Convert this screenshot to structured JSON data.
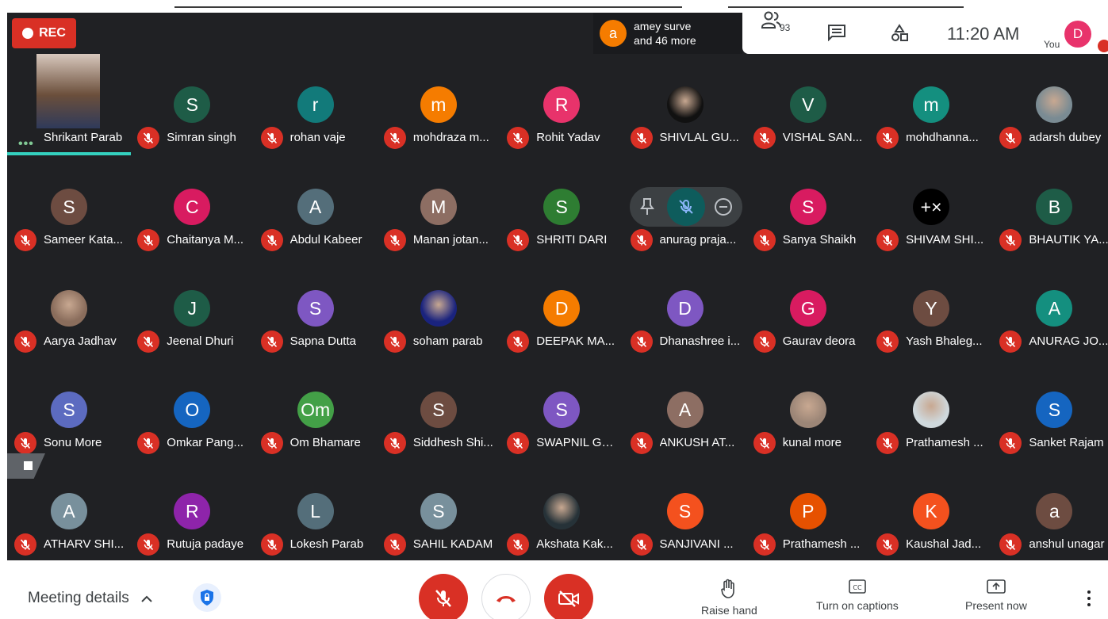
{
  "recording": {
    "label": "REC"
  },
  "speaker": {
    "avatar_letter": "a",
    "line1": "amey surve",
    "line2": "and 46 more"
  },
  "top_right": {
    "people_count": "93",
    "time": "11:20 AM",
    "you_label": "You",
    "self_initial": "D"
  },
  "participants": [
    {
      "name": "Shrikant Parab",
      "letter": "",
      "color": "#6b4f3b",
      "photo": true,
      "speaking": true
    },
    {
      "name": "Simran singh",
      "letter": "S",
      "color": "#1e5c47"
    },
    {
      "name": "rohan vaje",
      "letter": "r",
      "color": "#127a7a"
    },
    {
      "name": "mohdraza m...",
      "letter": "m",
      "color": "#f57c00"
    },
    {
      "name": "Rohit Yadav",
      "letter": "R",
      "color": "#e8336b"
    },
    {
      "name": "SHIVLAL GU...",
      "letter": "",
      "color": "#111111",
      "photo": true
    },
    {
      "name": "VISHAL SAN...",
      "letter": "V",
      "color": "#1e5c47"
    },
    {
      "name": "mohdhanna...",
      "letter": "m",
      "color": "#148f7f"
    },
    {
      "name": "adarsh dubey",
      "letter": "",
      "color": "#7a8b93",
      "photo": true
    },
    {
      "name": "Sameer Kata...",
      "letter": "S",
      "color": "#6d4c41"
    },
    {
      "name": "Chaitanya M...",
      "letter": "C",
      "color": "#d81b60"
    },
    {
      "name": "Abdul Kabeer",
      "letter": "A",
      "color": "#546e7a"
    },
    {
      "name": "Manan jotan...",
      "letter": "M",
      "color": "#8d6e63"
    },
    {
      "name": "SHRITI DARI",
      "letter": "S",
      "color": "#2e7d32"
    },
    {
      "name": "anurag praja...",
      "letter": "",
      "color": "#3c4043",
      "hidden_avatar": true
    },
    {
      "name": "Sanya Shaikh",
      "letter": "S",
      "color": "#d81b60"
    },
    {
      "name": "SHIVAM SHI...",
      "letter": "+×",
      "color": "#000000"
    },
    {
      "name": "BHAUTIK YA...",
      "letter": "B",
      "color": "#1e5c47"
    },
    {
      "name": "Aarya Jadhav",
      "letter": "",
      "color": "#8a6d5c",
      "photo": true
    },
    {
      "name": "Jeenal Dhuri",
      "letter": "J",
      "color": "#1e5c47"
    },
    {
      "name": "Sapna Dutta",
      "letter": "S",
      "color": "#7e57c2"
    },
    {
      "name": "soham parab",
      "letter": "",
      "color": "#1a237e",
      "photo": true
    },
    {
      "name": "DEEPAK MA...",
      "letter": "D",
      "color": "#f57c00"
    },
    {
      "name": "Dhanashree i...",
      "letter": "D",
      "color": "#7e57c2"
    },
    {
      "name": "Gaurav deora",
      "letter": "G",
      "color": "#d81b60"
    },
    {
      "name": "Yash Bhaleg...",
      "letter": "Y",
      "color": "#6d4c41"
    },
    {
      "name": "ANURAG JO...",
      "letter": "A",
      "color": "#148f7f"
    },
    {
      "name": "Sonu More",
      "letter": "S",
      "color": "#5c6bc0"
    },
    {
      "name": "Omkar Pang...",
      "letter": "O",
      "color": "#1565c0"
    },
    {
      "name": "Om Bhamare",
      "letter": "Om",
      "color": "#43a047"
    },
    {
      "name": "Siddhesh Shi...",
      "letter": "S",
      "color": "#6d4c41"
    },
    {
      "name": "SWAPNIL GO...",
      "letter": "S",
      "color": "#7e57c2"
    },
    {
      "name": "ANKUSH AT...",
      "letter": "A",
      "color": "#8d6e63"
    },
    {
      "name": "kunal more",
      "letter": "",
      "color": "#9c8677",
      "photo": true
    },
    {
      "name": "Prathamesh ...",
      "letter": "",
      "color": "#cfd8dc",
      "photo": true
    },
    {
      "name": "Sanket Rajam",
      "letter": "S",
      "color": "#1565c0"
    },
    {
      "name": "ATHARV SHI...",
      "letter": "A",
      "color": "#78909c"
    },
    {
      "name": "Rutuja padaye",
      "letter": "R",
      "color": "#8e24aa"
    },
    {
      "name": "Lokesh Parab",
      "letter": "L",
      "color": "#546e7a"
    },
    {
      "name": "SAHIL KADAM",
      "letter": "S",
      "color": "#78909c"
    },
    {
      "name": "Akshata Kak...",
      "letter": "",
      "color": "#263238",
      "photo": true
    },
    {
      "name": "SANJIVANI ...",
      "letter": "S",
      "color": "#f4511e"
    },
    {
      "name": "Prathamesh ...",
      "letter": "P",
      "color": "#e65100"
    },
    {
      "name": "Kaushal Jad...",
      "letter": "K",
      "color": "#f4511e"
    },
    {
      "name": "anshul unagar",
      "letter": "a",
      "color": "#6d4c41"
    }
  ],
  "bottom": {
    "meeting_details": "Meeting details",
    "raise_hand": "Raise hand",
    "captions": "Turn on captions",
    "present": "Present now"
  },
  "colors": {
    "red": "#d93025",
    "stage": "#202124"
  }
}
